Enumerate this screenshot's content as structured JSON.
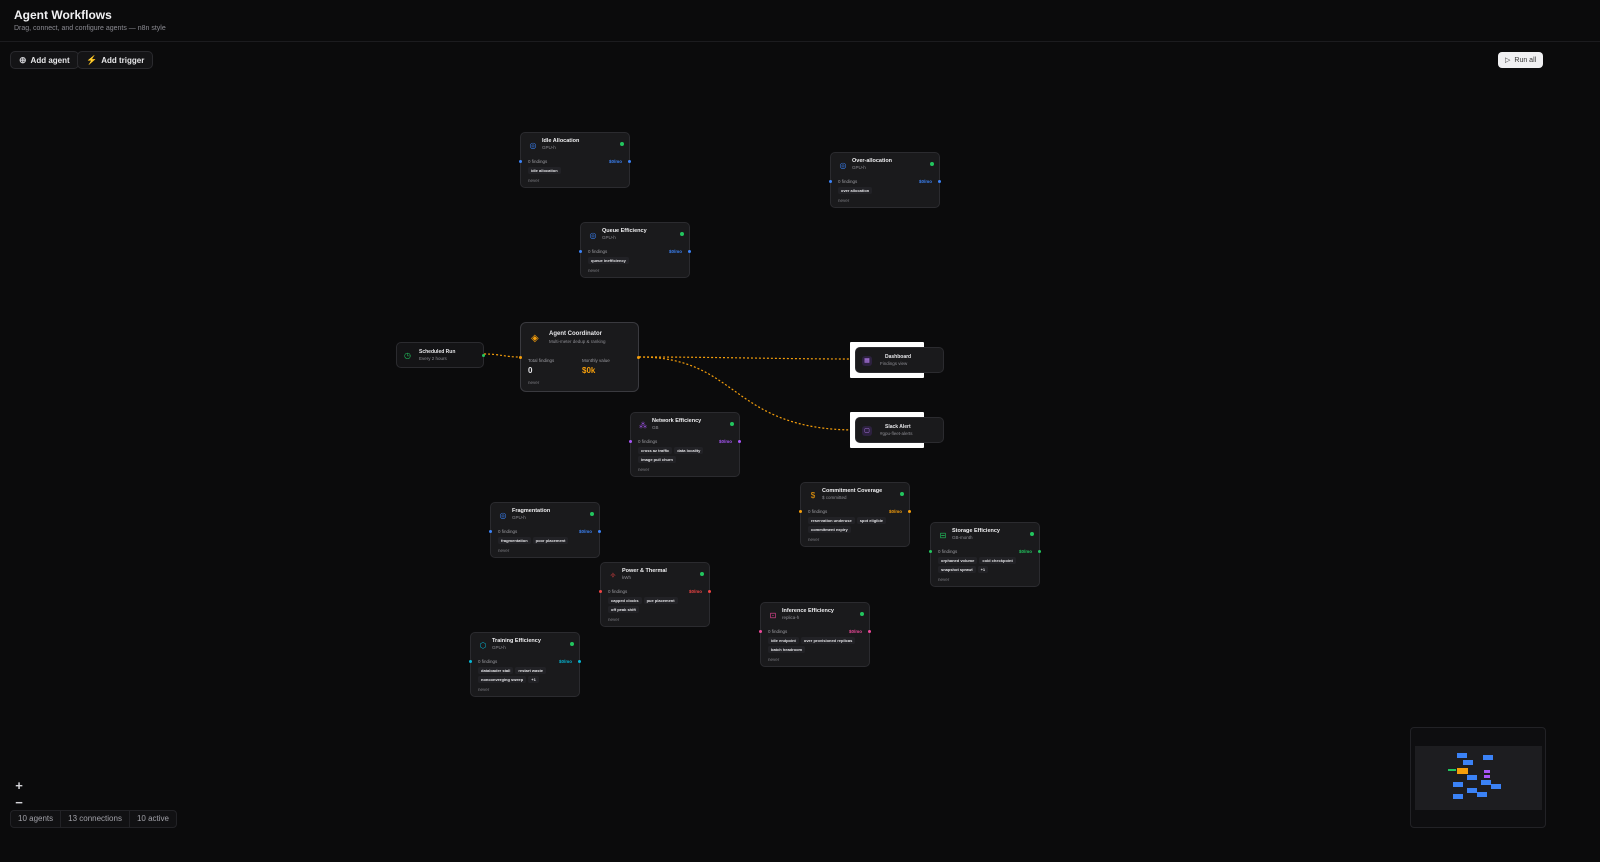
{
  "header": {
    "title": "Agent Workflows",
    "subtitle": "Drag, connect, and configure agents — n8n style"
  },
  "toolbar": {
    "add_agent": "Add agent",
    "add_trigger": "Add trigger",
    "run_all": "Run all"
  },
  "trigger": {
    "title": "Scheduled Run",
    "subtitle": "Every 2 hours"
  },
  "coordinator": {
    "title": "Agent Coordinator",
    "subtitle": "Multi-meter dedup & ranking",
    "total_label": "Total findings",
    "total_value": "0",
    "monthly_label": "Monthly value",
    "monthly_value": "$0k",
    "last_run": "never"
  },
  "outputs": [
    {
      "title": "Dashboard",
      "subtitle": "Findings view"
    },
    {
      "title": "Slack Alert",
      "subtitle": "#gpu-fleet-alerts"
    }
  ],
  "agents": [
    {
      "title": "Idle Allocation",
      "unit": "GPU-h",
      "findings": "0 findings",
      "value": "$0/mo",
      "tags": [
        "idle allocation"
      ],
      "last_run": "never",
      "color": "#3b82f6"
    },
    {
      "title": "Over-allocation",
      "unit": "GPU-h",
      "findings": "0 findings",
      "value": "$0/mo",
      "tags": [
        "over allocation"
      ],
      "last_run": "never",
      "color": "#3b82f6"
    },
    {
      "title": "Queue Efficiency",
      "unit": "GPU-h",
      "findings": "0 findings",
      "value": "$0/mo",
      "tags": [
        "queue inefficiency"
      ],
      "last_run": "never",
      "color": "#3b82f6"
    },
    {
      "title": "Network Efficiency",
      "unit": "GB",
      "findings": "0 findings",
      "value": "$0/mo",
      "tags": [
        "cross az traffic",
        "data locality",
        "image pull churn"
      ],
      "last_run": "never",
      "color": "#a855f7"
    },
    {
      "title": "Commitment Coverage",
      "unit": "$ committed",
      "findings": "0 findings",
      "value": "$0/mo",
      "tags": [
        "reservation underuse",
        "spot eligible",
        "commitment expiry"
      ],
      "last_run": "never",
      "color": "#f59e0b"
    },
    {
      "title": "Fragmentation",
      "unit": "GPU-h",
      "findings": "0 findings",
      "value": "$0/mo",
      "tags": [
        "fragmentation",
        "poor placement"
      ],
      "last_run": "never",
      "color": "#3b82f6"
    },
    {
      "title": "Storage Efficiency",
      "unit": "GB-month",
      "findings": "0 findings",
      "value": "$0/mo",
      "tags": [
        "orphaned volume",
        "cold checkpoint",
        "snapshot sprawl",
        "+1"
      ],
      "last_run": "never",
      "color": "#22c55e"
    },
    {
      "title": "Power & Thermal",
      "unit": "kWh",
      "findings": "0 findings",
      "value": "$0/mo",
      "tags": [
        "capped clocks",
        "pue placement",
        "off peak shift"
      ],
      "last_run": "never",
      "color": "#ef4444"
    },
    {
      "title": "Inference Efficiency",
      "unit": "replica-h",
      "findings": "0 findings",
      "value": "$0/mo",
      "tags": [
        "idle endpoint",
        "over provisioned replicas",
        "batch headroom"
      ],
      "last_run": "never",
      "color": "#ec4899"
    },
    {
      "title": "Training Efficiency",
      "unit": "GPU-h",
      "findings": "0 findings",
      "value": "$0/mo",
      "tags": [
        "dataloader stall",
        "restart waste",
        "nonconverging sweep",
        "+1"
      ],
      "last_run": "never",
      "color": "#06b6d4"
    }
  ],
  "zoom": {
    "in": "+",
    "out": "−"
  },
  "statusbar": {
    "agents": "10 agents",
    "connections": "13 connections",
    "active": "10 active"
  },
  "colors": {
    "accent": "#f59e0b",
    "background": "#0b0b0c",
    "node": "#1a1a1c",
    "active": "#22c55e"
  }
}
